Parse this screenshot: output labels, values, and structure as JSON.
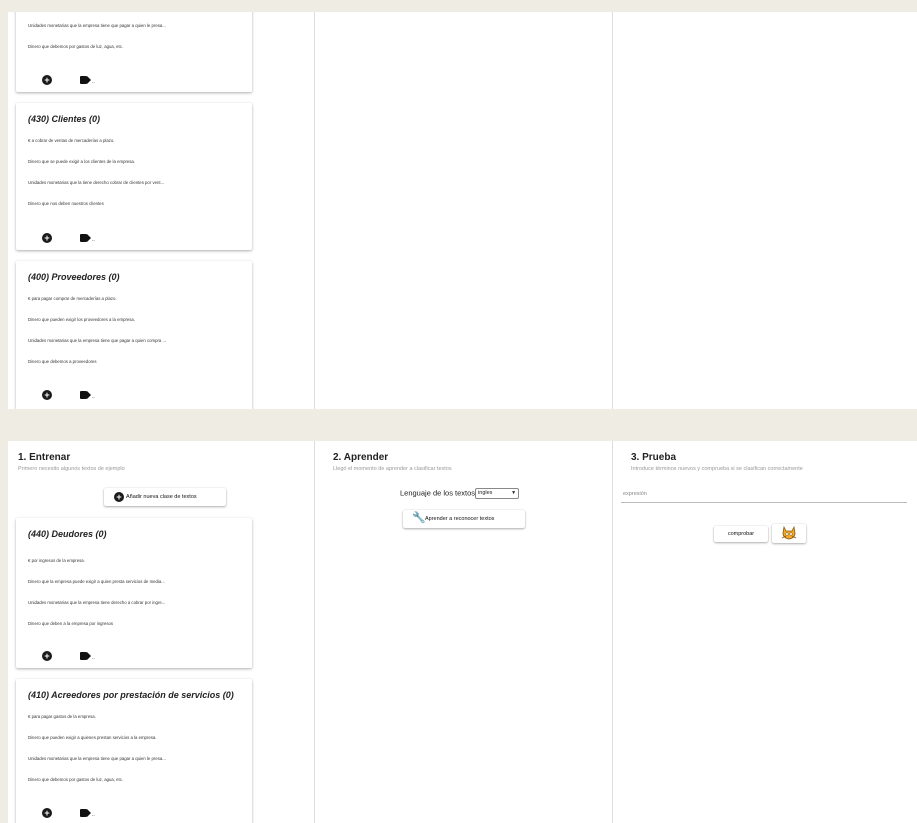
{
  "top_panel": {
    "partial_card": {
      "lines": [
        "Unidades monetarias que la empresa tiene que pagar a quien le presa...",
        "Dinero que debemos por gastos de luz, agua, etc."
      ]
    },
    "cards": [
      {
        "title": "(430) Clientes (0)",
        "lines": [
          "€ a cobrar de ventas de mercaderías a plazo.",
          "Dinero que se puede exigir a los clientes de la empresa.",
          "Unidades monetarias que la tiene derecho cobrar de clientes por vent...",
          "Dinero que nos deben nuestros clientes"
        ]
      },
      {
        "title": "(400) Proveedores (0)",
        "lines": [
          "€ para pagar comprar de mercaderías a plazo.",
          "Dinero que pueden exigir los proveedores a la empresa.",
          "Unidades monetarias que la empresa tiene que pagar a quien compra ...",
          "Dinero que debemos a proveedores"
        ]
      }
    ]
  },
  "train": {
    "title": "1. Entrenar",
    "subtitle": "Primero necesito algunos textos de ejemplo",
    "add_class_label": "Añadir nueva clase de textos",
    "cards": [
      {
        "title": "(440) Deudores (0)",
        "lines": [
          "€ por ingresos de la empresa.",
          "Dinero que la empresa puede exigir a quien presta servicios de media...",
          "Unidades monetarias que la empresa tiene derecho a cobrar por ingre...",
          "Dinero que deben a la empresa por ingresos"
        ]
      },
      {
        "title": "(410) Acreedores por prestación de servicios (0)",
        "lines": [
          "€ para pagar gastos de la empresa.",
          "Dinero que pueden exigir a quienes prestan servicios a la empresa.",
          "Unidades monetarias que la empresa tiene que pagar a quien le presa...",
          "Dinero que debemos por gastos de luz, agua, etc."
        ]
      }
    ]
  },
  "learn": {
    "title": "2. Aprender",
    "subtitle": "Llegó el momento de aprender a clasificar textos",
    "language_label": "Lenguaje de los textos",
    "language_value": "ingles",
    "learn_button_label": "Aprender a reconocer textos"
  },
  "test": {
    "title": "3. Prueba",
    "subtitle": "Introduce términos nuevos y comprueba si se clasifican correctamente",
    "input_placeholder": "expresión",
    "check_button_label": "comprobar"
  },
  "colors": {
    "page_background": "#efece3",
    "panel_background": "#ffffff",
    "icon_dark": "#1a1a1a",
    "scratch_cat": "#f7a823"
  },
  "icons": {
    "add": "plus-circle-icon",
    "tag": "label-icon",
    "learn": "wrench-icon",
    "check_extra": "scratch-cat-icon"
  }
}
